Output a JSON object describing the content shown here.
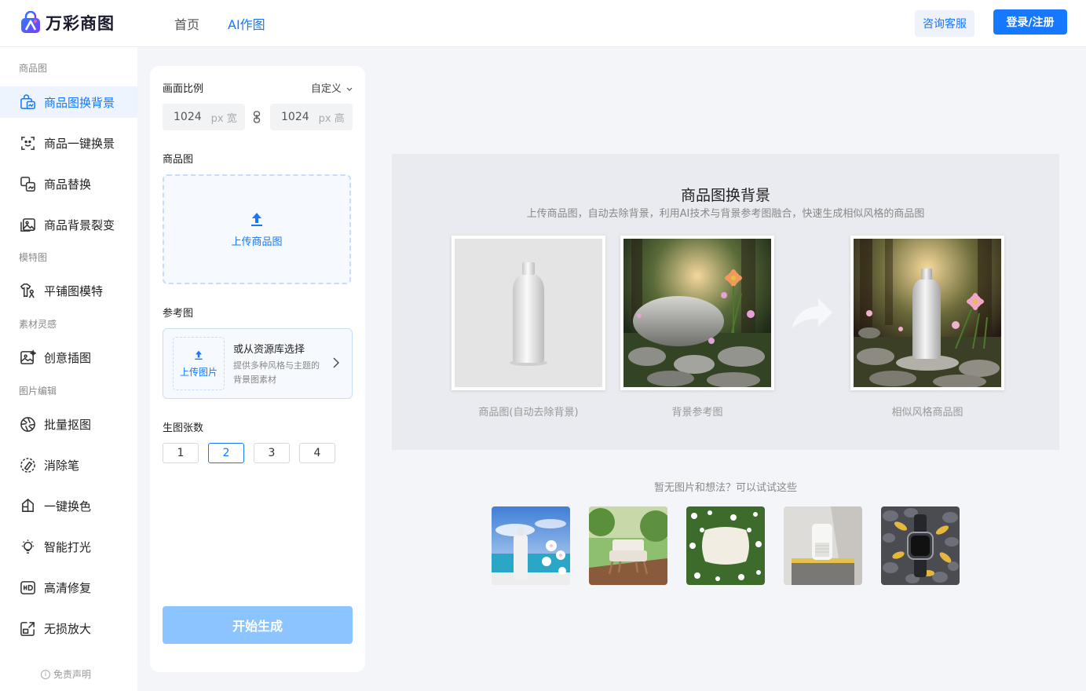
{
  "header": {
    "logo_text": "万彩商图",
    "nav": [
      {
        "label": "首页",
        "active": false
      },
      {
        "label": "AI作图",
        "active": true
      }
    ],
    "consult_label": "咨询客服",
    "login_label": "登录/注册"
  },
  "sidebar": {
    "groups": {
      "product": "商品图",
      "model": "模特图",
      "material": "素材灵感",
      "edit": "图片编辑"
    },
    "items": [
      {
        "label": "商品图换背景",
        "icon": "bag-swap-icon",
        "active": true
      },
      {
        "label": "商品一键换景",
        "icon": "scan-smile-icon",
        "active": false
      },
      {
        "label": "商品替换",
        "icon": "replace-icon",
        "active": false
      },
      {
        "label": "商品背景裂变",
        "icon": "images-icon",
        "active": false
      },
      {
        "label": "平铺图模特",
        "icon": "shirt-model-icon",
        "active": false
      },
      {
        "label": "创意插图",
        "icon": "creative-image-icon",
        "active": false
      },
      {
        "label": "批量抠图",
        "icon": "aperture-icon",
        "active": false
      },
      {
        "label": "消除笔",
        "icon": "eraser-circle-icon",
        "active": false
      },
      {
        "label": "一键换色",
        "icon": "color-swap-icon",
        "active": false
      },
      {
        "label": "智能打光",
        "icon": "bulb-icon",
        "active": false
      },
      {
        "label": "高清修复",
        "icon": "hd-icon",
        "active": false
      },
      {
        "label": "无损放大",
        "icon": "enlarge-icon",
        "active": false
      }
    ],
    "disclaimer": "免责声明"
  },
  "panel": {
    "ratio_label": "画面比例",
    "ratio_value": "自定义",
    "width_value": "1024",
    "width_unit": "px 宽",
    "height_value": "1024",
    "height_unit": "px 高",
    "product_label": "商品图",
    "upload_product": "上传商品图",
    "reference_label": "参考图",
    "upload_image": "上传图片",
    "library_title": "或从资源库选择",
    "library_desc": "提供多种风格与主题的背景图素材",
    "count_label": "生图张数",
    "count_options": [
      "1",
      "2",
      "3",
      "4"
    ],
    "count_selected": "2",
    "generate_label": "开始生成"
  },
  "demo": {
    "title": "商品图换背景",
    "subtitle": "上传商品图，自动去除背景，利用AI技术与背景参考图融合，快速生成相似风格的商品图",
    "captions": [
      "商品图(自动去除背景)",
      "背景参考图",
      "相似风格商品图"
    ]
  },
  "suggestions": {
    "title": "暂无图片和想法？可以试试这些",
    "items": [
      "beach-bottle-image",
      "garden-chair-image",
      "flower-pillow-image",
      "purifier-image",
      "watch-pebbles-image"
    ]
  },
  "colors": {
    "accent": "#1677ff",
    "accent_light": "#eef4fe",
    "button_disabled": "#8cc4ff"
  }
}
